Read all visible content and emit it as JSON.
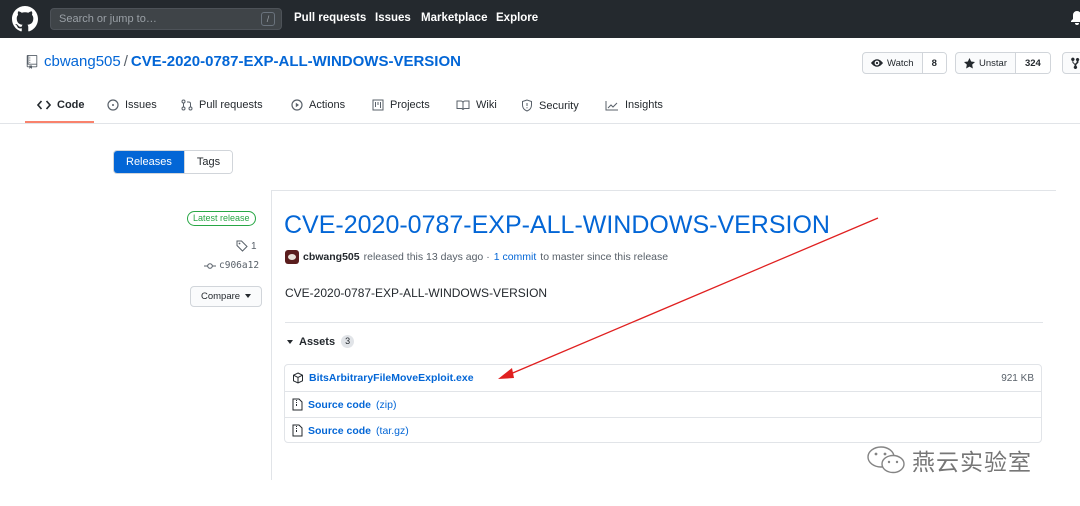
{
  "header": {
    "search_placeholder": "Search or jump to…",
    "search_hotkey": "/",
    "nav": [
      "Pull requests",
      "Issues",
      "Marketplace",
      "Explore"
    ]
  },
  "repo": {
    "owner": "cbwang505",
    "separator": "/",
    "name": "CVE-2020-0787-EXP-ALL-WINDOWS-VERSION",
    "watch_label": "Watch",
    "watch_count": "8",
    "unstar_label": "Unstar",
    "star_count": "324"
  },
  "tabs": [
    {
      "label": "Code"
    },
    {
      "label": "Issues"
    },
    {
      "label": "Pull requests"
    },
    {
      "label": "Actions"
    },
    {
      "label": "Projects"
    },
    {
      "label": "Wiki"
    },
    {
      "label": "Security"
    },
    {
      "label": "Insights"
    }
  ],
  "toggle": {
    "releases": "Releases",
    "tags": "Tags"
  },
  "release": {
    "badge": "Latest release",
    "tag_count": "1",
    "commit_sha": "c906a12",
    "compare_label": "Compare",
    "title": "CVE-2020-0787-EXP-ALL-WINDOWS-VERSION",
    "author": "cbwang505",
    "meta_mid": "released this 13 days ago ·",
    "commit_link": "1 commit",
    "meta_end": "to master since this release",
    "body": "CVE-2020-0787-EXP-ALL-WINDOWS-VERSION",
    "assets_label": "Assets",
    "assets_count": "3",
    "assets": [
      {
        "name": "BitsArbitraryFileMoveExploit.exe",
        "ext": "",
        "size": "921 KB"
      },
      {
        "name": "Source code",
        "ext": "(zip)",
        "size": ""
      },
      {
        "name": "Source code",
        "ext": "(tar.gz)",
        "size": ""
      }
    ]
  },
  "watermark": {
    "text": "燕云实验室"
  },
  "colors": {
    "accent": "#0366d6",
    "header_bg": "#24292e",
    "arrow": "#e02020",
    "latest": "#28a745"
  }
}
